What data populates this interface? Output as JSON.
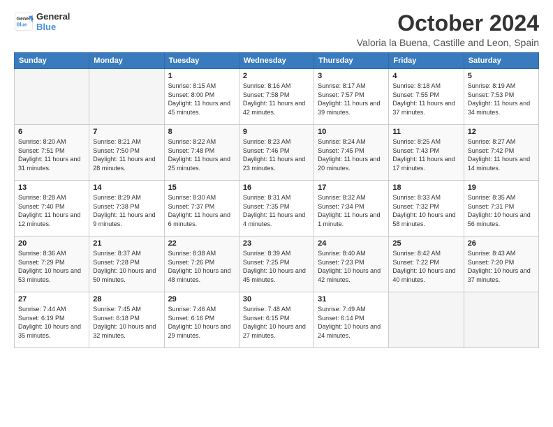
{
  "logo": {
    "line1": "General",
    "line2": "Blue"
  },
  "header": {
    "month": "October 2024",
    "location": "Valoria la Buena, Castille and Leon, Spain"
  },
  "weekdays": [
    "Sunday",
    "Monday",
    "Tuesday",
    "Wednesday",
    "Thursday",
    "Friday",
    "Saturday"
  ],
  "weeks": [
    [
      {
        "day": "",
        "info": ""
      },
      {
        "day": "",
        "info": ""
      },
      {
        "day": "1",
        "info": "Sunrise: 8:15 AM\nSunset: 8:00 PM\nDaylight: 11 hours and 45 minutes."
      },
      {
        "day": "2",
        "info": "Sunrise: 8:16 AM\nSunset: 7:58 PM\nDaylight: 11 hours and 42 minutes."
      },
      {
        "day": "3",
        "info": "Sunrise: 8:17 AM\nSunset: 7:57 PM\nDaylight: 11 hours and 39 minutes."
      },
      {
        "day": "4",
        "info": "Sunrise: 8:18 AM\nSunset: 7:55 PM\nDaylight: 11 hours and 37 minutes."
      },
      {
        "day": "5",
        "info": "Sunrise: 8:19 AM\nSunset: 7:53 PM\nDaylight: 11 hours and 34 minutes."
      }
    ],
    [
      {
        "day": "6",
        "info": "Sunrise: 8:20 AM\nSunset: 7:51 PM\nDaylight: 11 hours and 31 minutes."
      },
      {
        "day": "7",
        "info": "Sunrise: 8:21 AM\nSunset: 7:50 PM\nDaylight: 11 hours and 28 minutes."
      },
      {
        "day": "8",
        "info": "Sunrise: 8:22 AM\nSunset: 7:48 PM\nDaylight: 11 hours and 25 minutes."
      },
      {
        "day": "9",
        "info": "Sunrise: 8:23 AM\nSunset: 7:46 PM\nDaylight: 11 hours and 23 minutes."
      },
      {
        "day": "10",
        "info": "Sunrise: 8:24 AM\nSunset: 7:45 PM\nDaylight: 11 hours and 20 minutes."
      },
      {
        "day": "11",
        "info": "Sunrise: 8:25 AM\nSunset: 7:43 PM\nDaylight: 11 hours and 17 minutes."
      },
      {
        "day": "12",
        "info": "Sunrise: 8:27 AM\nSunset: 7:42 PM\nDaylight: 11 hours and 14 minutes."
      }
    ],
    [
      {
        "day": "13",
        "info": "Sunrise: 8:28 AM\nSunset: 7:40 PM\nDaylight: 11 hours and 12 minutes."
      },
      {
        "day": "14",
        "info": "Sunrise: 8:29 AM\nSunset: 7:38 PM\nDaylight: 11 hours and 9 minutes."
      },
      {
        "day": "15",
        "info": "Sunrise: 8:30 AM\nSunset: 7:37 PM\nDaylight: 11 hours and 6 minutes."
      },
      {
        "day": "16",
        "info": "Sunrise: 8:31 AM\nSunset: 7:35 PM\nDaylight: 11 hours and 4 minutes."
      },
      {
        "day": "17",
        "info": "Sunrise: 8:32 AM\nSunset: 7:34 PM\nDaylight: 11 hours and 1 minute."
      },
      {
        "day": "18",
        "info": "Sunrise: 8:33 AM\nSunset: 7:32 PM\nDaylight: 10 hours and 58 minutes."
      },
      {
        "day": "19",
        "info": "Sunrise: 8:35 AM\nSunset: 7:31 PM\nDaylight: 10 hours and 56 minutes."
      }
    ],
    [
      {
        "day": "20",
        "info": "Sunrise: 8:36 AM\nSunset: 7:29 PM\nDaylight: 10 hours and 53 minutes."
      },
      {
        "day": "21",
        "info": "Sunrise: 8:37 AM\nSunset: 7:28 PM\nDaylight: 10 hours and 50 minutes."
      },
      {
        "day": "22",
        "info": "Sunrise: 8:38 AM\nSunset: 7:26 PM\nDaylight: 10 hours and 48 minutes."
      },
      {
        "day": "23",
        "info": "Sunrise: 8:39 AM\nSunset: 7:25 PM\nDaylight: 10 hours and 45 minutes."
      },
      {
        "day": "24",
        "info": "Sunrise: 8:40 AM\nSunset: 7:23 PM\nDaylight: 10 hours and 42 minutes."
      },
      {
        "day": "25",
        "info": "Sunrise: 8:42 AM\nSunset: 7:22 PM\nDaylight: 10 hours and 40 minutes."
      },
      {
        "day": "26",
        "info": "Sunrise: 8:43 AM\nSunset: 7:20 PM\nDaylight: 10 hours and 37 minutes."
      }
    ],
    [
      {
        "day": "27",
        "info": "Sunrise: 7:44 AM\nSunset: 6:19 PM\nDaylight: 10 hours and 35 minutes."
      },
      {
        "day": "28",
        "info": "Sunrise: 7:45 AM\nSunset: 6:18 PM\nDaylight: 10 hours and 32 minutes."
      },
      {
        "day": "29",
        "info": "Sunrise: 7:46 AM\nSunset: 6:16 PM\nDaylight: 10 hours and 29 minutes."
      },
      {
        "day": "30",
        "info": "Sunrise: 7:48 AM\nSunset: 6:15 PM\nDaylight: 10 hours and 27 minutes."
      },
      {
        "day": "31",
        "info": "Sunrise: 7:49 AM\nSunset: 6:14 PM\nDaylight: 10 hours and 24 minutes."
      },
      {
        "day": "",
        "info": ""
      },
      {
        "day": "",
        "info": ""
      }
    ]
  ]
}
